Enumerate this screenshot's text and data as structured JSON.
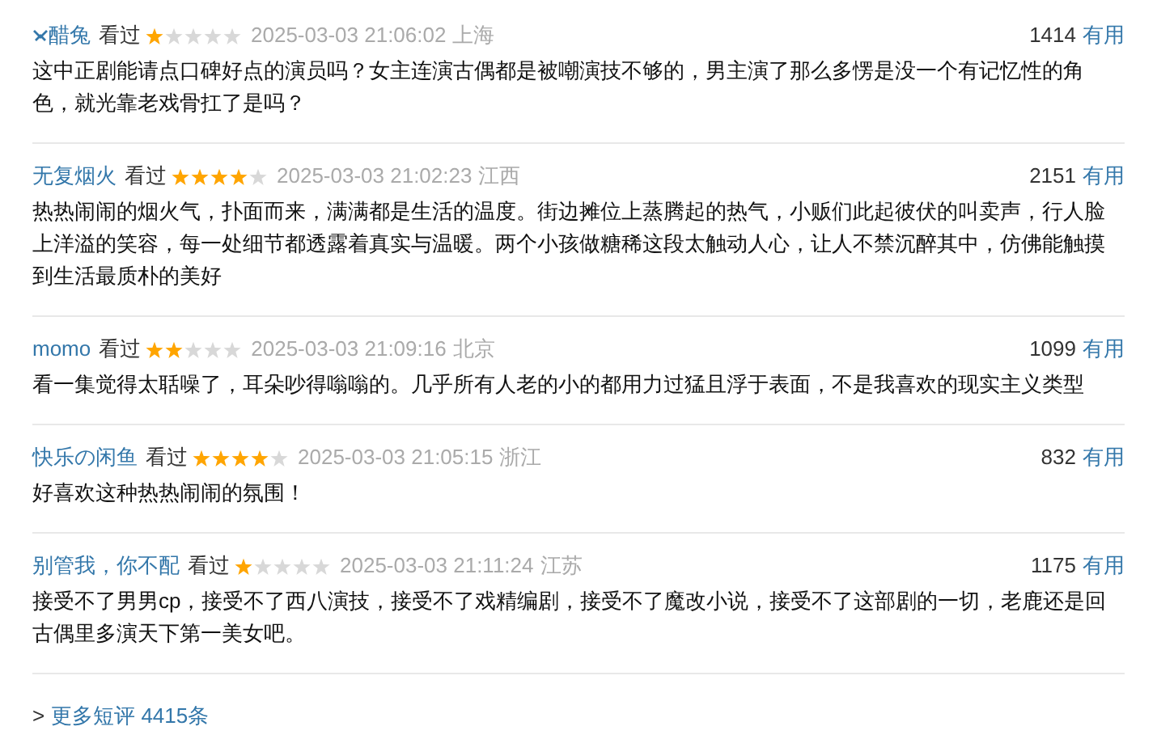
{
  "comments": [
    {
      "user": "醋兔",
      "user_icon": true,
      "status": "看过",
      "stars": 1,
      "time": "2025-03-03 21:06:02",
      "location": "上海",
      "votes": "1414",
      "vote_label": "有用",
      "text": "这中正剧能请点口碑好点的演员吗？女主连演古偶都是被嘲演技不够的，男主演了那么多愣是没一个有记忆性的角色，就光靠老戏骨扛了是吗？"
    },
    {
      "user": "无复烟火",
      "user_icon": false,
      "status": "看过",
      "stars": 4,
      "time": "2025-03-03 21:02:23",
      "location": "江西",
      "votes": "2151",
      "vote_label": "有用",
      "text": "热热闹闹的烟火气，扑面而来，满满都是生活的温度。街边摊位上蒸腾起的热气，小贩们此起彼伏的叫卖声，行人脸上洋溢的笑容，每一处细节都透露着真实与温暖。两个小孩做糖稀这段太触动人心，让人不禁沉醉其中，仿佛能触摸到生活最质朴的美好"
    },
    {
      "user": "momo",
      "user_icon": false,
      "status": "看过",
      "stars": 2,
      "time": "2025-03-03 21:09:16",
      "location": "北京",
      "votes": "1099",
      "vote_label": "有用",
      "text": "看一集觉得太聒噪了，耳朵吵得嗡嗡的。几乎所有人老的小的都用力过猛且浮于表面，不是我喜欢的现实主义类型"
    },
    {
      "user": "快乐の闲鱼",
      "user_icon": false,
      "status": "看过",
      "stars": 4,
      "time": "2025-03-03 21:05:15",
      "location": "浙江",
      "votes": "832",
      "vote_label": "有用",
      "text": "好喜欢这种热热闹闹的氛围！"
    },
    {
      "user": "别管我，你不配",
      "user_icon": false,
      "status": "看过",
      "stars": 1,
      "time": "2025-03-03 21:11:24",
      "location": "江苏",
      "votes": "1175",
      "vote_label": "有用",
      "text": "接受不了男男cp，接受不了西八演技，接受不了戏精编剧，接受不了魔改小说，接受不了这部剧的一切，老鹿还是回古偶里多演天下第一美女吧。"
    }
  ],
  "more": {
    "arrow": ">",
    "label": "更多短评 4415条"
  }
}
